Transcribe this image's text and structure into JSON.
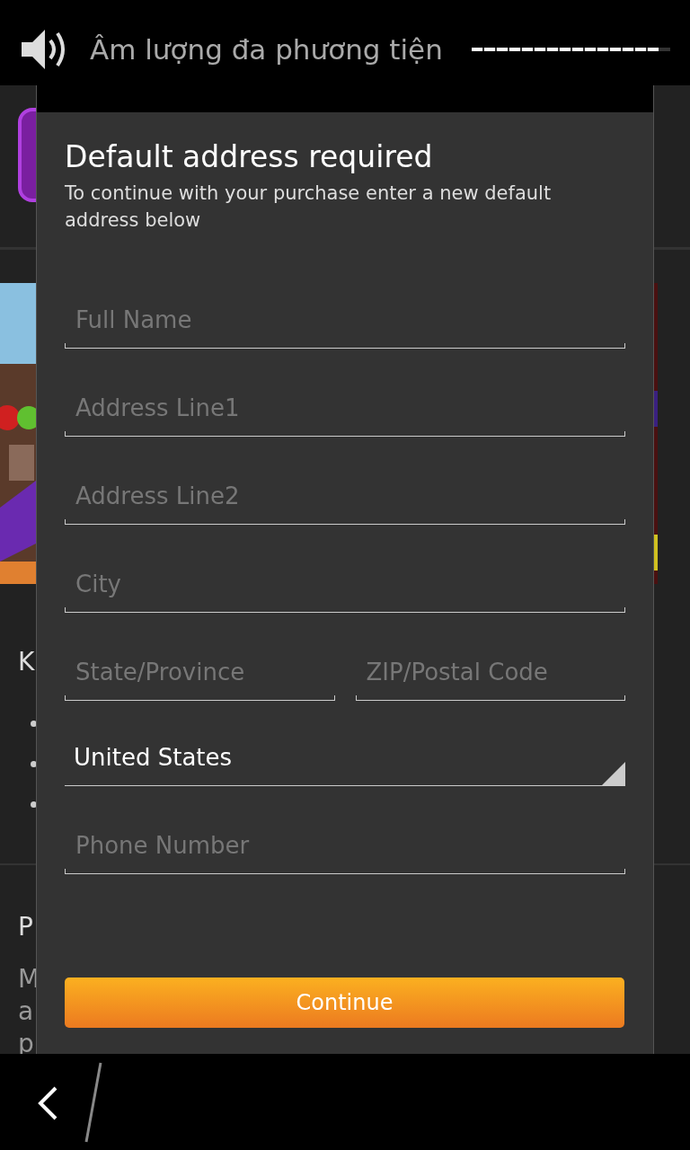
{
  "volume_toast": {
    "label": "Âm lượng đa phương tiện",
    "level": 0.94
  },
  "background_page": {
    "heading_1": "K",
    "heading_2": "P",
    "paragraph_lines": [
      "M",
      "a",
      "p"
    ]
  },
  "dialog": {
    "title": "Default address required",
    "subtitle": "To continue with your purchase enter a new default address below",
    "fields": [
      {
        "kind": "text",
        "placeholder": "Full Name"
      },
      {
        "kind": "text",
        "placeholder": "Address Line1"
      },
      {
        "kind": "text",
        "placeholder": "Address Line2"
      },
      {
        "kind": "text",
        "placeholder": "City"
      },
      {
        "kind": "pair",
        "items": [
          {
            "placeholder": "State/Province"
          },
          {
            "placeholder": "ZIP/Postal Code"
          }
        ]
      },
      {
        "kind": "select",
        "value": "United States"
      },
      {
        "kind": "text",
        "placeholder": "Phone Number"
      }
    ],
    "button": "Continue"
  }
}
